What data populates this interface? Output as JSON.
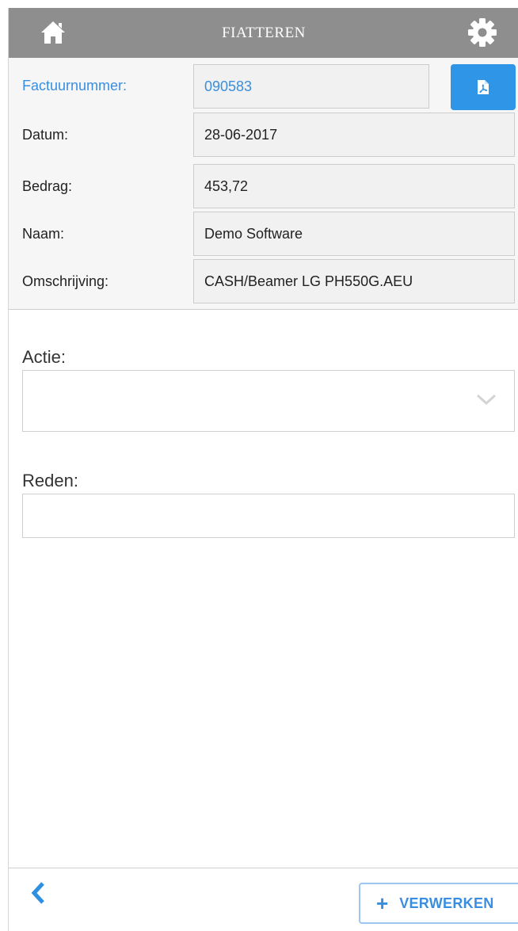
{
  "header": {
    "title": "FIATTEREN",
    "home_icon": "home-icon",
    "settings_icon": "gear-icon"
  },
  "details": {
    "rows": [
      {
        "label": "Factuurnummer:",
        "value": "090583"
      },
      {
        "label": "Datum:",
        "value": "28-06-2017"
      },
      {
        "label": "Bedrag:",
        "value": "453,72"
      },
      {
        "label": "Naam:",
        "value": "Demo Software"
      },
      {
        "label": "Omschrijving:",
        "value": "CASH/Beamer LG PH550G.AEU"
      }
    ],
    "pdf_icon": "pdf-file-icon"
  },
  "form": {
    "action_label": "Actie:",
    "action_value": "",
    "reason_label": "Reden:",
    "reason_value": ""
  },
  "footer": {
    "back_icon": "chevron-left-icon",
    "process_label": "VERWERKEN"
  },
  "colors": {
    "header_bg": "#8e8e8e",
    "accent": "#3a8ee0",
    "pdf_button": "#2f95e6"
  }
}
